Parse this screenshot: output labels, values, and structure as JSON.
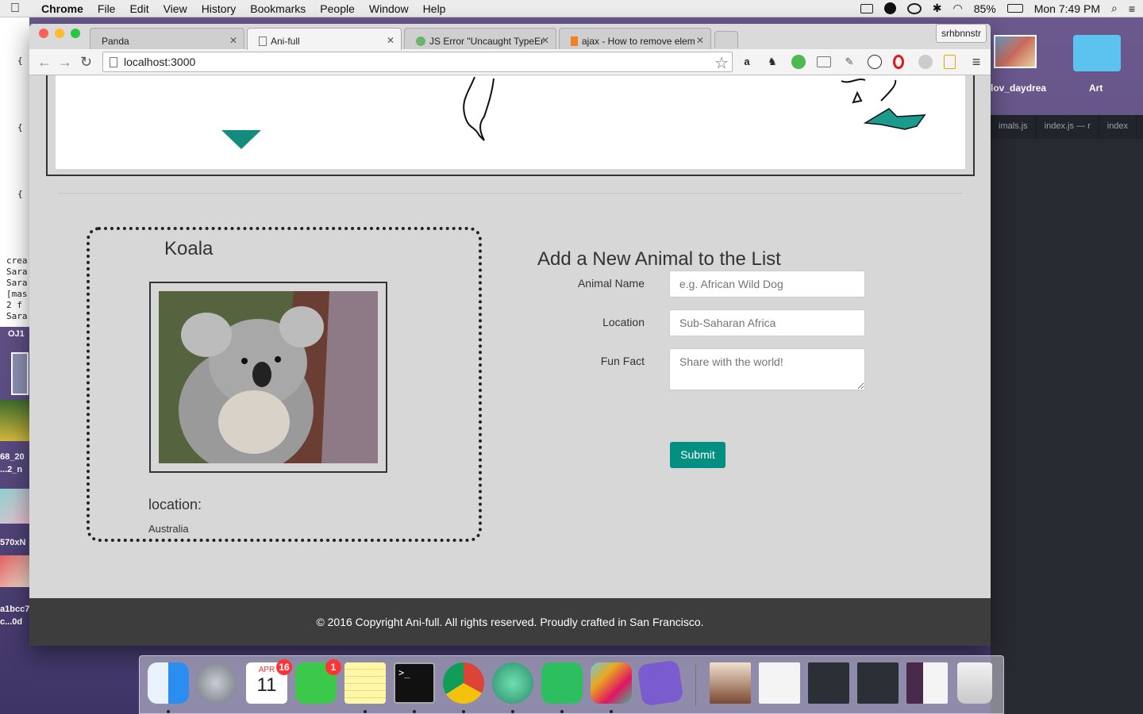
{
  "menubar": {
    "app": "Chrome",
    "items": [
      "File",
      "Edit",
      "View",
      "History",
      "Bookmarks",
      "People",
      "Window",
      "Help"
    ],
    "battery": "85%",
    "clock": "Mon 7:49 PM"
  },
  "desktop": {
    "file1": "lov_daydrea",
    "folder": "Art",
    "editor_tabs": [
      "imals.js",
      "index.js — r",
      "index"
    ],
    "left_term_lines": [
      "{",
      "{",
      "{",
      "crea",
      "Sara",
      "Sara",
      "[mas",
      " 2 f",
      "Sara"
    ],
    "left_labels": [
      "OJ1",
      "68_20",
      "...2_n",
      "570xN",
      "a1bcc7",
      "c...0d"
    ]
  },
  "browser": {
    "tabs": [
      {
        "label": "Panda",
        "active": false
      },
      {
        "label": "Ani-full",
        "active": true
      },
      {
        "label": "JS Error \"Uncaught TypeEr",
        "active": false
      },
      {
        "label": "ajax - How to remove elem",
        "active": false
      }
    ],
    "profile": "srhbnnstr",
    "url": "localhost:3000"
  },
  "page": {
    "card": {
      "name": "Koala",
      "location_label": "location:",
      "location_value": "Australia"
    },
    "form": {
      "title": "Add a New Animal to the List",
      "name_label": "Animal Name",
      "name_placeholder": "e.g. African Wild Dog",
      "location_label": "Location",
      "location_placeholder": "Sub-Saharan Africa",
      "fact_label": "Fun Fact",
      "fact_placeholder": "Share with the world!",
      "submit": "Submit"
    },
    "footer": "© 2016 Copyright Ani-full. All rights reserved. Proudly crafted in San Francisco."
  },
  "dock": {
    "calendar_month": "APR",
    "calendar_day": "11",
    "calendar_badge": "16",
    "facetime_badge": "1"
  },
  "colors": {
    "accent": "#008f80",
    "footer_bg": "#3d3d3d",
    "page_bg": "#d7d7d7"
  }
}
